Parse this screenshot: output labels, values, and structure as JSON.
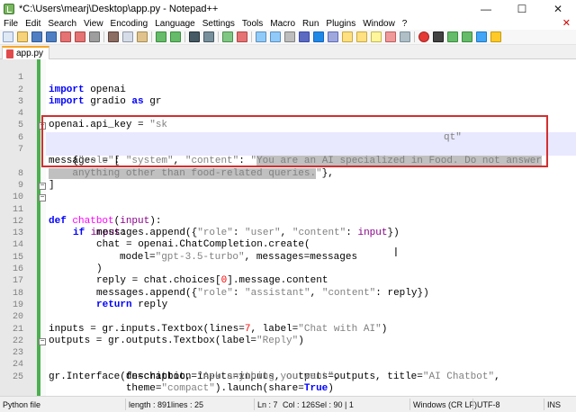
{
  "window": {
    "title": "*C:\\Users\\mearj\\Desktop\\app.py - Notepad++",
    "minimize": "—",
    "maximize": "☐",
    "close": "✕"
  },
  "menu": [
    "File",
    "Edit",
    "Search",
    "View",
    "Encoding",
    "Language",
    "Settings",
    "Tools",
    "Macro",
    "Run",
    "Plugins",
    "Window",
    "?"
  ],
  "menu_close": "✕",
  "tab": {
    "label": "app.py",
    "close": "✕"
  },
  "editor": {
    "lines": [
      {
        "n": "1"
      },
      {
        "n": "2"
      },
      {
        "n": "3"
      },
      {
        "n": "4"
      },
      {
        "n": "5"
      },
      {
        "n": "6"
      },
      {
        "n": "7"
      },
      {
        "n": ""
      },
      {
        "n": "8"
      },
      {
        "n": "9"
      },
      {
        "n": "10"
      },
      {
        "n": "11"
      },
      {
        "n": "12"
      },
      {
        "n": "13"
      },
      {
        "n": "14"
      },
      {
        "n": "15"
      },
      {
        "n": "16"
      },
      {
        "n": "17"
      },
      {
        "n": "18"
      },
      {
        "n": "19"
      },
      {
        "n": "20"
      },
      {
        "n": "21"
      },
      {
        "n": "22"
      },
      {
        "n": "23"
      },
      {
        "n": "24"
      },
      {
        "n": "25"
      },
      {
        "n": ""
      }
    ],
    "code": {
      "l1_kw": "import",
      "l1_rest": " openai",
      "l2_kw1": "import",
      "l2_mid": " gradio ",
      "l2_kw2": "as",
      "l2_rest": " gr",
      "l4_a": "openai.api_key = ",
      "l4_str1": "\"sk",
      "l4_str2": "qt\"",
      "l6": "messages = [",
      "l7_a": "    {",
      "l7_s1": "\"role\"",
      "l7_b": ": ",
      "l7_s2": "\"system\"",
      "l7_c": ", ",
      "l7_s3": "\"content\"",
      "l7_d": ": ",
      "l7_s4": "\"",
      "l7_sel": "You are an AI specialized in Food. Do not answer",
      "l7w_sel": "    anything other than food-related queries.",
      "l7w_s": "\"",
      "l7w_end": "},",
      "l8": "]",
      "l10_kw": "def",
      "l10_fn": " chatbot",
      "l10_a": "(",
      "l10_p": "input",
      "l10_b": "):",
      "l11_kw": "if",
      "l11_p": " input",
      "l11_b": ":",
      "l12_a": "messages.append({",
      "l12_s1": "\"role\"",
      "l12_b": ": ",
      "l12_s2": "\"user\"",
      "l12_c": ", ",
      "l12_s3": "\"content\"",
      "l12_d": ": ",
      "l12_p": "input",
      "l12_e": "})",
      "l13_a": "chat = openai.ChatCompletion.create(",
      "l14_a": "model=",
      "l14_s": "\"gpt-3.5-turbo\"",
      "l14_b": ", messages=messages",
      "l15": ")",
      "l16_a": "reply = chat.choices[",
      "l16_n": "0",
      "l16_b": "].message.content",
      "l17_a": "messages.append({",
      "l17_s1": "\"role\"",
      "l17_b": ": ",
      "l17_s2": "\"assistant\"",
      "l17_c": ", ",
      "l17_s3": "\"content\"",
      "l17_d": ": reply})",
      "l18_kw": "return",
      "l18_rest": " reply",
      "l20_a": "inputs = gr.inputs.Textbox(lines=",
      "l20_n": "7",
      "l20_b": ", label=",
      "l20_s": "\"Chat with AI\"",
      "l20_c": ")",
      "l21_a": "outputs = gr.outputs.Textbox(label=",
      "l21_s": "\"Reply\"",
      "l21_b": ")",
      "l23_a": "gr.Interface(fn=chatbot, inputs=inputs, outputs=outputs, title=",
      "l23_s": "\"AI Chatbot\"",
      "l23_b": ",",
      "l24_a": "             description=",
      "l24_s": "\"Ask anything you want\"",
      "l24_b": ",",
      "l25_a": "             theme=",
      "l25_s": "\"compact\"",
      "l25_b": ").launch(share=",
      "l25_kw": "True",
      "l25_c": ")"
    }
  },
  "status": {
    "lang": "Python file",
    "length": "length : 891",
    "lines": "lines : 25",
    "ln": "Ln : 7",
    "col": "Col : 126",
    "sel": "Sel : 90 | 1",
    "eol": "Windows (CR LF)",
    "enc": "UTF-8",
    "mode": "INS"
  },
  "colors": {
    "keyword": "#0000ff",
    "string": "#808080",
    "function": "#ff00ff",
    "number": "#ff0000",
    "fold_bar": "#4caf50",
    "highlight_box": "#d32f2f",
    "tab_accent": "#f5a623"
  }
}
